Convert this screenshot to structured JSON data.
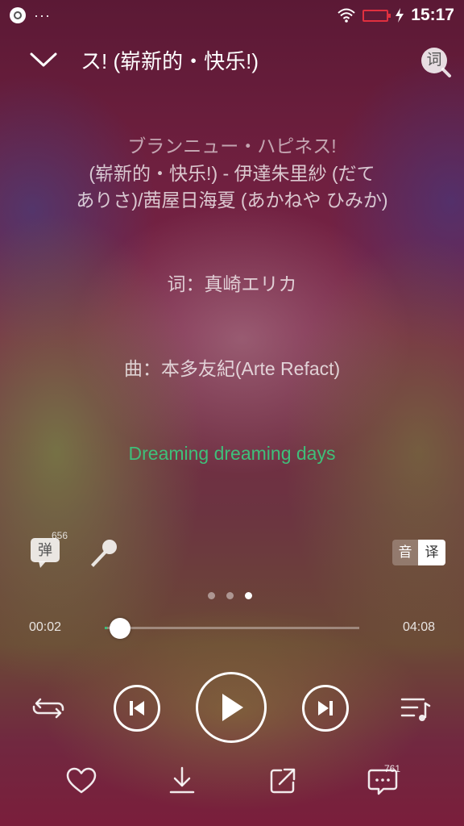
{
  "status_bar": {
    "dots": "···",
    "time": "15:17"
  },
  "header": {
    "title": "ス! (崭新的・快乐!)",
    "lyric_search_label": "词"
  },
  "lyrics": {
    "lines": [
      "ブランニュー・ハピネス!",
      "(崭新的・快乐!) - 伊達朱里紗 (だて",
      "ありさ)/茜屋日海夏 (あかねや ひみか)",
      "词：真崎エリカ",
      "曲：本多友紀(Arte Refact)",
      "Dreaming dreaming days"
    ]
  },
  "tools": {
    "danmaku_label": "弹",
    "danmaku_count": "656",
    "lang_original": "音",
    "lang_translation": "译"
  },
  "pager": {
    "count": 3,
    "active_index": 2
  },
  "progress": {
    "current": "00:02",
    "total": "04:08",
    "fraction": 0.008
  },
  "actions": {
    "comment_count": "761"
  },
  "colors": {
    "accent": "#3fbf7a",
    "battery": "#e0303f"
  }
}
